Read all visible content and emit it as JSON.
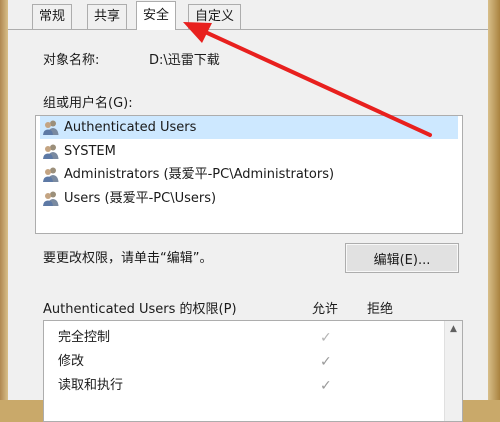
{
  "tabs": [
    {
      "label": "常规"
    },
    {
      "label": "共享"
    },
    {
      "label": "安全"
    },
    {
      "label": "自定义"
    }
  ],
  "object": {
    "label": "对象名称:",
    "value": "D:\\迅雷下载"
  },
  "groups": {
    "label": "组或用户名(G):",
    "items": [
      {
        "name": "Authenticated Users"
      },
      {
        "name": "SYSTEM"
      },
      {
        "name": "Administrators (聂爱平-PC\\Administrators)"
      },
      {
        "name": "Users (聂爱平-PC\\Users)"
      }
    ],
    "selected_index": 0
  },
  "change_hint": "要更改权限，请单击“编辑”。",
  "edit_button": "编辑(E)...",
  "permissions": {
    "title": "Authenticated Users 的权限(P)",
    "allow_header": "允许",
    "deny_header": "拒绝",
    "rows": [
      {
        "name": "完全控制",
        "allow": false,
        "allow_mark": "✓"
      },
      {
        "name": "修改",
        "allow": true,
        "allow_mark": "✓"
      },
      {
        "name": "读取和执行",
        "allow": true,
        "allow_mark": "✓"
      }
    ]
  },
  "annotation": {
    "arrow_color": "#e8201e"
  },
  "colors": {
    "dialog_bg": "#f0f0f0",
    "selection": "#cde8ff",
    "border": "#adadad"
  }
}
